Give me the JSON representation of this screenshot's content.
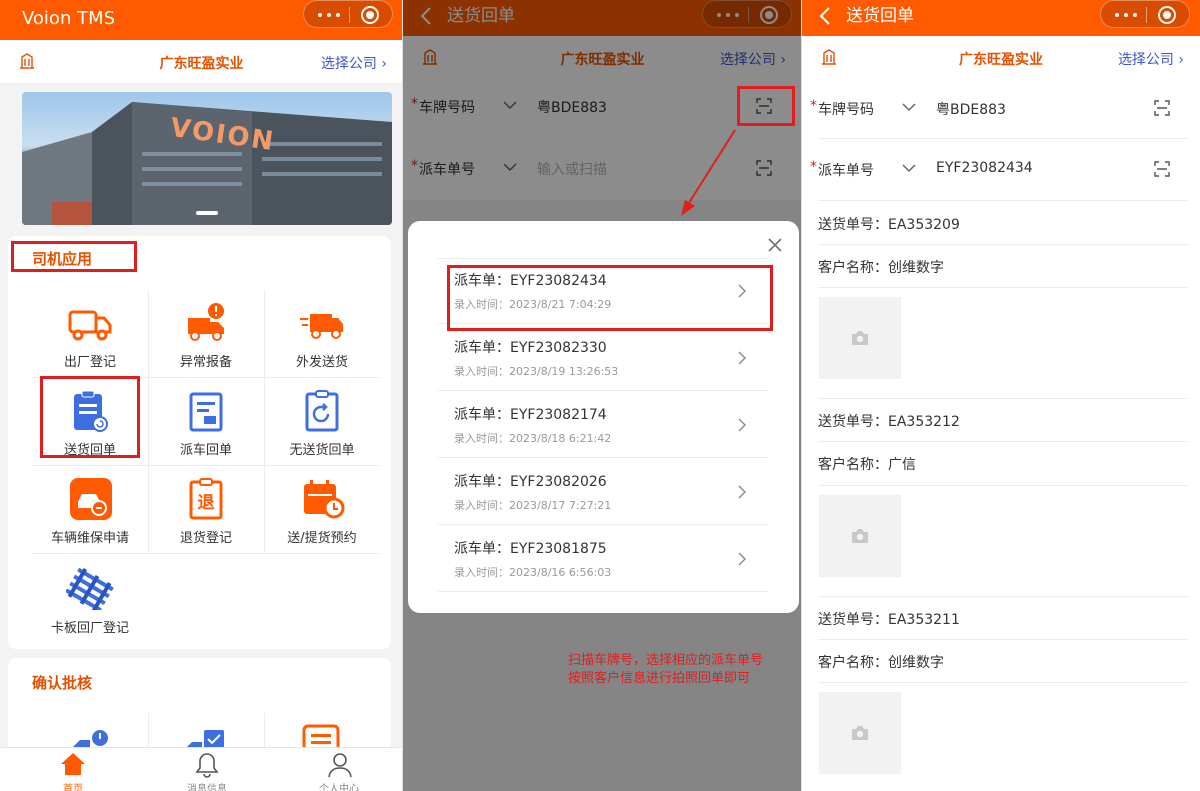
{
  "app": {
    "title": "Voion TMS"
  },
  "company": {
    "name": "广东旺盈实业",
    "select_label": "选择公司 ›"
  },
  "home": {
    "driver_section_title": "司机应用",
    "driver_apps": [
      {
        "label": "出厂登记",
        "icon": "truck-outline-icon"
      },
      {
        "label": "异常报备",
        "icon": "truck-alert-icon"
      },
      {
        "label": "外发送货",
        "icon": "fast-truck-icon"
      },
      {
        "label": "送货回单",
        "icon": "receipt-return-icon"
      },
      {
        "label": "派车回单",
        "icon": "dispatch-receipt-icon"
      },
      {
        "label": "无送货回单",
        "icon": "no-delivery-receipt-icon"
      },
      {
        "label": "车辆维保申请",
        "icon": "car-repair-icon"
      },
      {
        "label": "退货登记",
        "icon": "return-icon"
      },
      {
        "label": "送/提货预约",
        "icon": "calendar-clock-icon"
      },
      {
        "label": "卡板回厂登记",
        "icon": "pallet-icon"
      }
    ],
    "confirm_section_title": "确认批核",
    "banner_text": "VOION",
    "tabs": [
      {
        "label": "首页",
        "icon": "home-icon"
      },
      {
        "label": "消息信息",
        "icon": "bell-icon"
      },
      {
        "label": "个人中心",
        "icon": "user-icon"
      }
    ]
  },
  "receipt_page": {
    "title": "送货回单",
    "plate_label": "车牌号码",
    "plate_value": "粤BDE883",
    "dispatch_label": "派车单号",
    "dispatch_placeholder": "输入或扫描",
    "dispatch_value": "EYF23082434",
    "required_mark": "*"
  },
  "dispatch_modal": {
    "items": [
      {
        "title": "派车单：EYF23082434",
        "time": "录入时间：2023/8/21 7:04:29"
      },
      {
        "title": "派车单：EYF23082330",
        "time": "录入时间：2023/8/19 13:26:53"
      },
      {
        "title": "派车单：EYF23082174",
        "time": "录入时间：2023/8/18 6:21:42"
      },
      {
        "title": "派车单：EYF23082026",
        "time": "录入时间：2023/8/17 7:27:21"
      },
      {
        "title": "派车单：EYF23081875",
        "time": "录入时间：2023/8/16 6:56:03"
      }
    ]
  },
  "annotation": {
    "line1": "扫描车牌号，选择相应的派车单号",
    "line2": "按照客户信息进行拍照回单即可"
  },
  "receipt_details": [
    {
      "delivery_no": "送货单号：EA353209",
      "customer": "客户名称：创维数字"
    },
    {
      "delivery_no": "送货单号：EA353212",
      "customer": "客户名称：广信"
    },
    {
      "delivery_no": "送货单号：EA353211",
      "customer": "客户名称：创维数字"
    }
  ],
  "colors": {
    "brand": "#ff5a00",
    "accent_text": "#e65100",
    "link": "#3f55c7",
    "highlight": "#e01e1e",
    "icon_blue": "#3d6fe0"
  }
}
